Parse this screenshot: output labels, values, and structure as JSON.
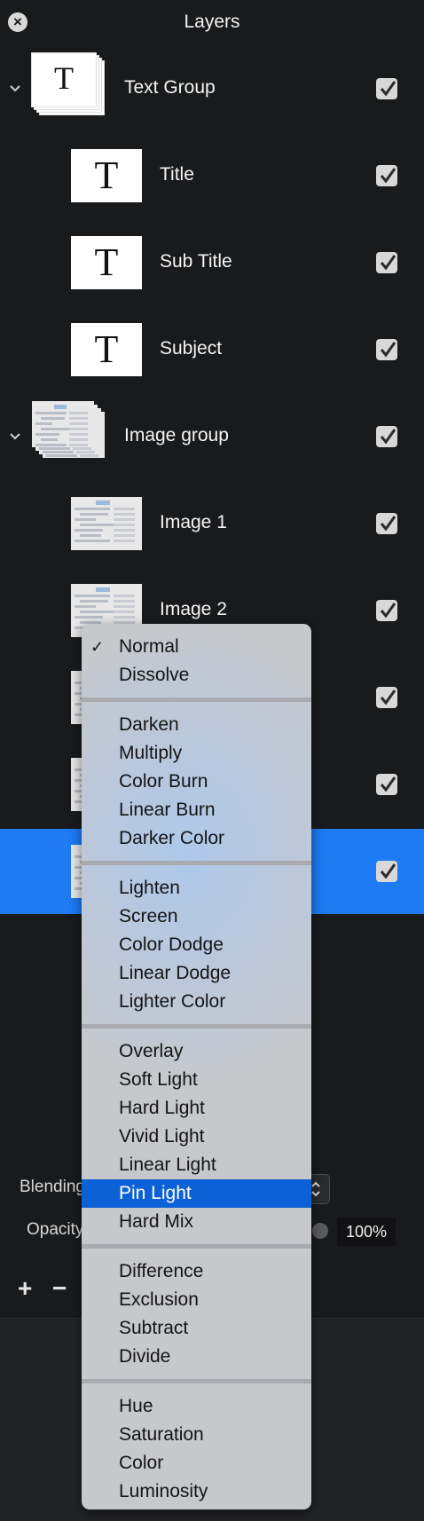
{
  "panel": {
    "title": "Layers"
  },
  "layers": [
    {
      "label": "Text Group",
      "kind": "text-group",
      "checked": true
    },
    {
      "label": "Title",
      "kind": "text",
      "checked": true
    },
    {
      "label": "Sub Title",
      "kind": "text",
      "checked": true
    },
    {
      "label": "Subject",
      "kind": "text",
      "checked": true
    },
    {
      "label": "Image group",
      "kind": "image-group",
      "checked": true
    },
    {
      "label": "Image 1",
      "kind": "image",
      "checked": true
    },
    {
      "label": "Image 2",
      "kind": "image",
      "checked": true
    },
    {
      "label": "",
      "kind": "image",
      "checked": true
    },
    {
      "label": "",
      "kind": "image",
      "checked": true
    },
    {
      "label": "",
      "kind": "image",
      "checked": true,
      "selected": true
    }
  ],
  "thumb_letter": "T",
  "controls": {
    "blending_label": "Blending",
    "opacity_label": "Opacity",
    "opacity_value": "100%"
  },
  "bottom": {
    "add_label": "+",
    "remove_label": "−"
  },
  "blend_menu": {
    "groups": [
      [
        "Normal",
        "Dissolve"
      ],
      [
        "Darken",
        "Multiply",
        "Color Burn",
        "Linear Burn",
        "Darker Color"
      ],
      [
        "Lighten",
        "Screen",
        "Color Dodge",
        "Linear Dodge",
        "Lighter Color"
      ],
      [
        "Overlay",
        "Soft Light",
        "Hard Light",
        "Vivid Light",
        "Linear Light",
        "Pin Light",
        "Hard Mix"
      ],
      [
        "Difference",
        "Exclusion",
        "Subtract",
        "Divide"
      ],
      [
        "Hue",
        "Saturation",
        "Color",
        "Luminosity"
      ]
    ],
    "checked": "Normal",
    "highlighted": "Pin Light"
  },
  "colors": {
    "selection": "#1e7bf3",
    "menu_highlight": "#0d61d6",
    "panel_bg": "#191a1c"
  }
}
